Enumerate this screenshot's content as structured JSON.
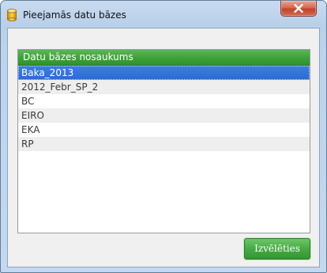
{
  "window": {
    "title": "Pieejamās datu bāzes",
    "close_label": "Close"
  },
  "list": {
    "header": "Datu bāzes nosaukums",
    "selected_index": 0,
    "items": [
      {
        "label": "Baka_2013"
      },
      {
        "label": "2012_Febr_SP_2"
      },
      {
        "label": "BC"
      },
      {
        "label": "EIRO"
      },
      {
        "label": "EKA"
      },
      {
        "label": "RP"
      }
    ]
  },
  "actions": {
    "select_label": "Izvēlēties"
  },
  "colors": {
    "header_green": "#3ea33b",
    "selection_blue": "#2b6bd2",
    "close_red": "#c2412a"
  },
  "icons": {
    "title": "database-icon",
    "close": "close-icon"
  }
}
